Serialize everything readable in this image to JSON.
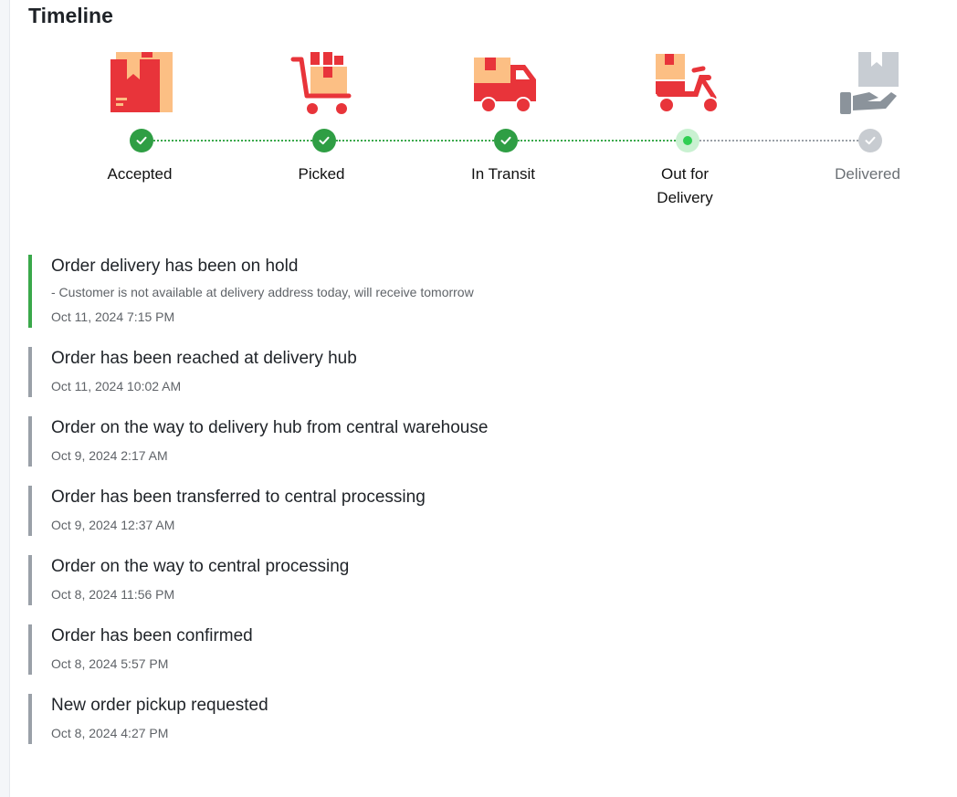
{
  "page": {
    "title": "Timeline"
  },
  "steps": [
    {
      "label": "Accepted",
      "state": "done",
      "icon": "box-icon"
    },
    {
      "label": "Picked",
      "state": "done",
      "icon": "cart-icon"
    },
    {
      "label": "In Transit",
      "state": "done",
      "icon": "truck-icon"
    },
    {
      "label_line1": "Out for",
      "label_line2": "Delivery",
      "state": "current",
      "icon": "scooter-icon"
    },
    {
      "label": "Delivered",
      "state": "todo",
      "icon": "hand-box-icon"
    }
  ],
  "events": [
    {
      "title": "Order delivery has been on hold",
      "note": "- Customer is not available at delivery address today, will receive tomorrow",
      "time": "Oct 11, 2024 7:15 PM"
    },
    {
      "title": "Order has been reached at delivery hub",
      "time": "Oct 11, 2024 10:02 AM"
    },
    {
      "title": "Order on the way to delivery hub from central warehouse",
      "time": "Oct 9, 2024 2:17 AM"
    },
    {
      "title": "Order has been transferred to central processing",
      "time": "Oct 9, 2024 12:37 AM"
    },
    {
      "title": "Order on the way to central processing",
      "time": "Oct 8, 2024 11:56 PM"
    },
    {
      "title": "Order has been confirmed",
      "time": "Oct 8, 2024 5:57 PM"
    },
    {
      "title": "New order pickup requested",
      "time": "Oct 8, 2024 4:27 PM"
    }
  ],
  "colors": {
    "accent_red": "#e8343a",
    "accent_peach": "#fcbf84",
    "done_green": "#2f9e44",
    "current_green": "#2fcf52",
    "muted_gray": "#c8ccd1",
    "active_bar": "#3aa84b",
    "inactive_bar": "#9aa0a8"
  }
}
